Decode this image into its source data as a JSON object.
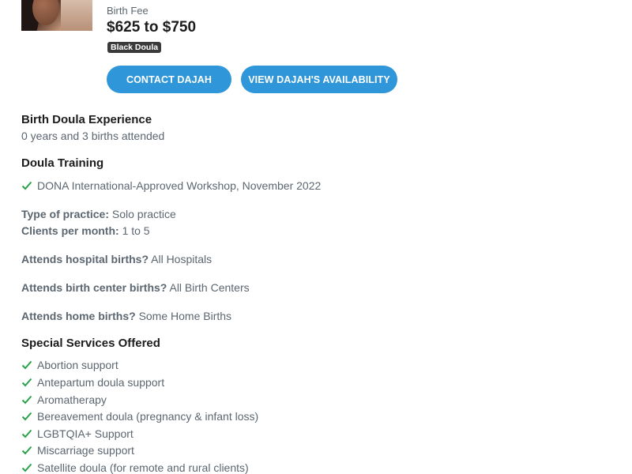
{
  "profile": {
    "fee_label": "Birth Fee",
    "fee_value": "$625 to $750",
    "badge": "Black Doula",
    "contact_button": "CONTACT DAJAH",
    "availability_button": "VIEW DAJAH'S AVAILABILITY"
  },
  "experience": {
    "title": "Birth Doula Experience",
    "value": "0 years and 3 births attended"
  },
  "training": {
    "title": "Doula Training",
    "items": [
      "DONA International-Approved Workshop, November 2022"
    ]
  },
  "practice": {
    "type_label": "Type of practice:",
    "type_value": "Solo practice",
    "clients_label": "Clients per month:",
    "clients_value": "1 to 5",
    "hospital_label": "Attends hospital births?",
    "hospital_value": "All Hospitals",
    "center_label": "Attends birth center births?",
    "center_value": "All Birth Centers",
    "home_label": "Attends home births?",
    "home_value": "Some Home Births"
  },
  "services": {
    "title": "Special Services Offered",
    "items": [
      "Abortion support",
      "Antepartum doula support",
      "Aromatherapy",
      "Bereavement doula (pregnancy & infant loss)",
      "LGBTQIA+ Support",
      "Miscarriage support",
      "Satellite doula (for remote and rural clients)"
    ]
  },
  "colors": {
    "accent": "#2f97d9",
    "check": "#2aa24a",
    "badge_bg": "#3a3a3a"
  }
}
